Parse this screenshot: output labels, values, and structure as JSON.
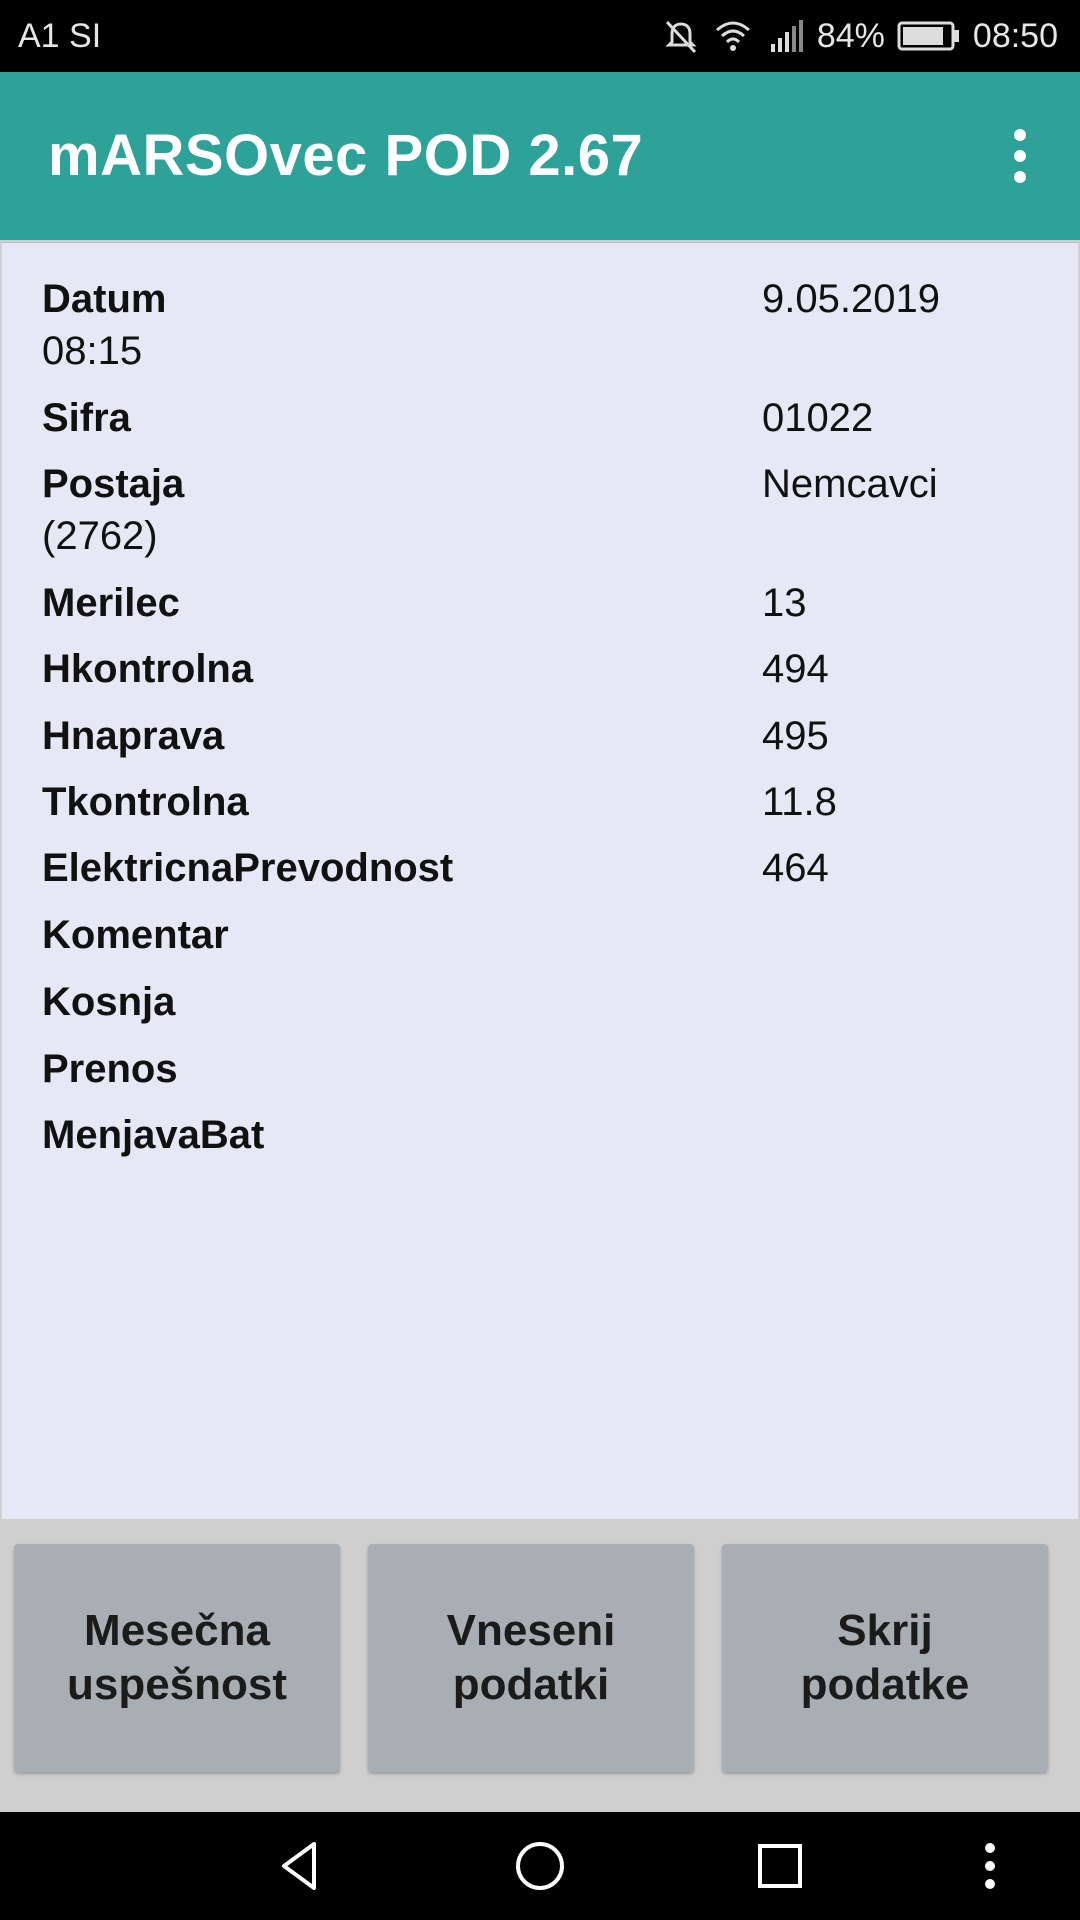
{
  "status_bar": {
    "carrier": "A1 SI",
    "battery_percent": "84%",
    "time": "08:50",
    "icons": [
      "mute-icon",
      "wifi-icon",
      "signal-icon",
      "battery-icon"
    ]
  },
  "app_bar": {
    "title": "mARSOvec POD 2.67",
    "menu_icon": "overflow-menu-icon"
  },
  "record": {
    "rows": [
      {
        "label": "Datum",
        "value": "9.05.2019",
        "sub": "08:15"
      },
      {
        "label": "Sifra",
        "value": "01022"
      },
      {
        "label": "Postaja",
        "value": "Nemcavci",
        "sub": "(2762)"
      },
      {
        "label": "Merilec",
        "value": "13"
      },
      {
        "label": "Hkontrolna",
        "value": "494"
      },
      {
        "label": "Hnaprava",
        "value": "495"
      },
      {
        "label": "Tkontrolna",
        "value": "11.8"
      },
      {
        "label": "ElektricnaPrevodnost",
        "value": "464"
      },
      {
        "label": "Komentar",
        "value": ""
      },
      {
        "label": "Kosnja",
        "value": ""
      },
      {
        "label": "Prenos",
        "value": ""
      },
      {
        "label": "MenjavaBat",
        "value": ""
      }
    ]
  },
  "buttons": {
    "monthly": "Mesečna\nuspešnost",
    "entered": "Vneseni\npodatki",
    "hide": "Skrij\npodatke"
  },
  "nav_bar": {
    "icons": [
      "back-icon",
      "home-icon",
      "recents-icon",
      "more-icon"
    ]
  },
  "colors": {
    "app_bar": "#2ea199",
    "content_bg": "#e7e8f6",
    "button_bg": "#a9adb4"
  }
}
